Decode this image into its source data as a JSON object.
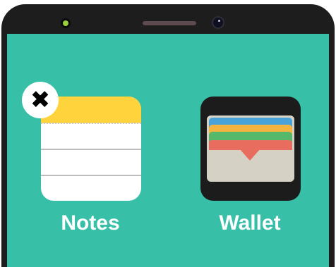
{
  "device": {
    "screen_color": "#38bfa7",
    "bezel_color": "#1d1d1d"
  },
  "apps": [
    {
      "label": "Notes",
      "icon": "notes-app-icon",
      "accent": "#fed33b"
    },
    {
      "label": "Wallet",
      "icon": "wallet-app-icon",
      "accent": "#1c1c1c"
    }
  ],
  "delete_badge": {
    "glyph": "✖",
    "icon": "close-icon"
  }
}
